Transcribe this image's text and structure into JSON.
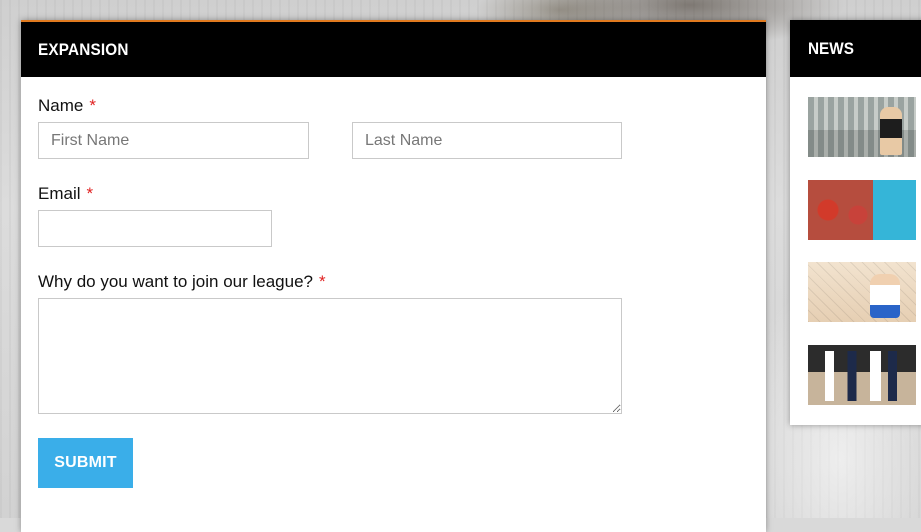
{
  "form": {
    "title": "EXPANSION",
    "name": {
      "label": "Name",
      "required_mark": "*",
      "first_placeholder": "First Name",
      "last_placeholder": "Last Name",
      "first_value": "",
      "last_value": ""
    },
    "email": {
      "label": "Email",
      "required_mark": "*",
      "value": ""
    },
    "reason": {
      "label": "Why do you want to join our league?",
      "required_mark": "*",
      "value": ""
    },
    "submit_label": "SUBMIT"
  },
  "news": {
    "title": "NEWS",
    "items": [
      {
        "icon": "volleyball-stadium-photo"
      },
      {
        "icon": "volleyball-crowd-photo"
      },
      {
        "icon": "volleyball-block-photo"
      },
      {
        "icon": "volleyball-team-photo"
      }
    ]
  },
  "colors": {
    "header_bg": "#000000",
    "accent_submit": "#3aaee9",
    "required": "#e02020",
    "border": "#c9c9c9"
  }
}
